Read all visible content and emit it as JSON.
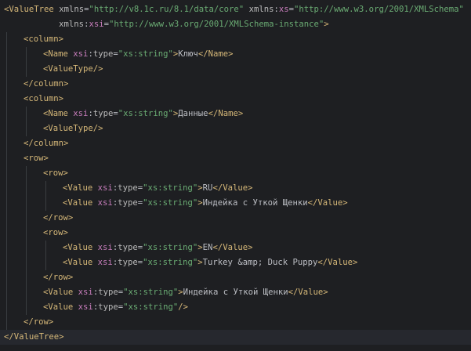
{
  "editor": {
    "language": "XML",
    "lines": [
      {
        "indent": 0,
        "tokens": [
          [
            "b",
            "<"
          ],
          [
            "t",
            "ValueTree"
          ],
          [
            "tx",
            " "
          ],
          [
            "an",
            "xmlns"
          ],
          [
            "p",
            "="
          ],
          [
            "av",
            "\"http://v8.1c.ru/8.1/data/core\""
          ],
          [
            "tx",
            " "
          ],
          [
            "an",
            "xmlns"
          ],
          [
            "p",
            ":"
          ],
          [
            "ap",
            "xs"
          ],
          [
            "p",
            "="
          ],
          [
            "av",
            "\"http://www.w3.org/2001/XMLSchema\""
          ]
        ]
      },
      {
        "indent": 0,
        "tokens": [
          [
            "tx",
            "           "
          ],
          [
            "an",
            "xmlns"
          ],
          [
            "p",
            ":"
          ],
          [
            "ap",
            "xsi"
          ],
          [
            "p",
            "="
          ],
          [
            "av",
            "\"http://www.w3.org/2001/XMLSchema-instance\""
          ],
          [
            "b",
            ">"
          ]
        ]
      },
      {
        "indent": 1,
        "tokens": [
          [
            "b",
            "<"
          ],
          [
            "t",
            "column"
          ],
          [
            "b",
            ">"
          ]
        ]
      },
      {
        "indent": 2,
        "tokens": [
          [
            "b",
            "<"
          ],
          [
            "t",
            "Name"
          ],
          [
            "tx",
            " "
          ],
          [
            "ap",
            "xsi"
          ],
          [
            "p",
            ":"
          ],
          [
            "an",
            "type"
          ],
          [
            "p",
            "="
          ],
          [
            "av",
            "\"xs:string\""
          ],
          [
            "b",
            ">"
          ],
          [
            "tx",
            "Ключ"
          ],
          [
            "b",
            "</"
          ],
          [
            "t",
            "Name"
          ],
          [
            "b",
            ">"
          ]
        ]
      },
      {
        "indent": 2,
        "tokens": [
          [
            "b",
            "<"
          ],
          [
            "t",
            "ValueType"
          ],
          [
            "b",
            "/>"
          ]
        ]
      },
      {
        "indent": 1,
        "tokens": [
          [
            "b",
            "</"
          ],
          [
            "t",
            "column"
          ],
          [
            "b",
            ">"
          ]
        ]
      },
      {
        "indent": 1,
        "tokens": [
          [
            "b",
            "<"
          ],
          [
            "t",
            "column"
          ],
          [
            "b",
            ">"
          ]
        ]
      },
      {
        "indent": 2,
        "tokens": [
          [
            "b",
            "<"
          ],
          [
            "t",
            "Name"
          ],
          [
            "tx",
            " "
          ],
          [
            "ap",
            "xsi"
          ],
          [
            "p",
            ":"
          ],
          [
            "an",
            "type"
          ],
          [
            "p",
            "="
          ],
          [
            "av",
            "\"xs:string\""
          ],
          [
            "b",
            ">"
          ],
          [
            "tx",
            "Данные"
          ],
          [
            "b",
            "</"
          ],
          [
            "t",
            "Name"
          ],
          [
            "b",
            ">"
          ]
        ]
      },
      {
        "indent": 2,
        "tokens": [
          [
            "b",
            "<"
          ],
          [
            "t",
            "ValueType"
          ],
          [
            "b",
            "/>"
          ]
        ]
      },
      {
        "indent": 1,
        "tokens": [
          [
            "b",
            "</"
          ],
          [
            "t",
            "column"
          ],
          [
            "b",
            ">"
          ]
        ]
      },
      {
        "indent": 1,
        "tokens": [
          [
            "b",
            "<"
          ],
          [
            "t",
            "row"
          ],
          [
            "b",
            ">"
          ]
        ]
      },
      {
        "indent": 2,
        "tokens": [
          [
            "b",
            "<"
          ],
          [
            "t",
            "row"
          ],
          [
            "b",
            ">"
          ]
        ]
      },
      {
        "indent": 3,
        "tokens": [
          [
            "b",
            "<"
          ],
          [
            "t",
            "Value"
          ],
          [
            "tx",
            " "
          ],
          [
            "ap",
            "xsi"
          ],
          [
            "p",
            ":"
          ],
          [
            "an",
            "type"
          ],
          [
            "p",
            "="
          ],
          [
            "av",
            "\"xs:string\""
          ],
          [
            "b",
            ">"
          ],
          [
            "tx",
            "RU"
          ],
          [
            "b",
            "</"
          ],
          [
            "t",
            "Value"
          ],
          [
            "b",
            ">"
          ]
        ]
      },
      {
        "indent": 3,
        "tokens": [
          [
            "b",
            "<"
          ],
          [
            "t",
            "Value"
          ],
          [
            "tx",
            " "
          ],
          [
            "ap",
            "xsi"
          ],
          [
            "p",
            ":"
          ],
          [
            "an",
            "type"
          ],
          [
            "p",
            "="
          ],
          [
            "av",
            "\"xs:string\""
          ],
          [
            "b",
            ">"
          ],
          [
            "tx",
            "Индейка с Уткой Щенки"
          ],
          [
            "b",
            "</"
          ],
          [
            "t",
            "Value"
          ],
          [
            "b",
            ">"
          ]
        ]
      },
      {
        "indent": 2,
        "tokens": [
          [
            "b",
            "</"
          ],
          [
            "t",
            "row"
          ],
          [
            "b",
            ">"
          ]
        ]
      },
      {
        "indent": 2,
        "tokens": [
          [
            "b",
            "<"
          ],
          [
            "t",
            "row"
          ],
          [
            "b",
            ">"
          ]
        ]
      },
      {
        "indent": 3,
        "tokens": [
          [
            "b",
            "<"
          ],
          [
            "t",
            "Value"
          ],
          [
            "tx",
            " "
          ],
          [
            "ap",
            "xsi"
          ],
          [
            "p",
            ":"
          ],
          [
            "an",
            "type"
          ],
          [
            "p",
            "="
          ],
          [
            "av",
            "\"xs:string\""
          ],
          [
            "b",
            ">"
          ],
          [
            "tx",
            "EN"
          ],
          [
            "b",
            "</"
          ],
          [
            "t",
            "Value"
          ],
          [
            "b",
            ">"
          ]
        ]
      },
      {
        "indent": 3,
        "tokens": [
          [
            "b",
            "<"
          ],
          [
            "t",
            "Value"
          ],
          [
            "tx",
            " "
          ],
          [
            "ap",
            "xsi"
          ],
          [
            "p",
            ":"
          ],
          [
            "an",
            "type"
          ],
          [
            "p",
            "="
          ],
          [
            "av",
            "\"xs:string\""
          ],
          [
            "b",
            ">"
          ],
          [
            "tx",
            "Turkey &amp; Duck Puppy"
          ],
          [
            "b",
            "</"
          ],
          [
            "t",
            "Value"
          ],
          [
            "b",
            ">"
          ]
        ]
      },
      {
        "indent": 2,
        "tokens": [
          [
            "b",
            "</"
          ],
          [
            "t",
            "row"
          ],
          [
            "b",
            ">"
          ]
        ]
      },
      {
        "indent": 2,
        "tokens": [
          [
            "b",
            "<"
          ],
          [
            "t",
            "Value"
          ],
          [
            "tx",
            " "
          ],
          [
            "ap",
            "xsi"
          ],
          [
            "p",
            ":"
          ],
          [
            "an",
            "type"
          ],
          [
            "p",
            "="
          ],
          [
            "av",
            "\"xs:string\""
          ],
          [
            "b",
            ">"
          ],
          [
            "tx",
            "Индейка с Уткой Щенки"
          ],
          [
            "b",
            "</"
          ],
          [
            "t",
            "Value"
          ],
          [
            "b",
            ">"
          ]
        ]
      },
      {
        "indent": 2,
        "tokens": [
          [
            "b",
            "<"
          ],
          [
            "t",
            "Value"
          ],
          [
            "tx",
            " "
          ],
          [
            "ap",
            "xsi"
          ],
          [
            "p",
            ":"
          ],
          [
            "an",
            "type"
          ],
          [
            "p",
            "="
          ],
          [
            "av",
            "\"xs:string\""
          ],
          [
            "b",
            "/>"
          ]
        ]
      },
      {
        "indent": 1,
        "tokens": [
          [
            "b",
            "</"
          ],
          [
            "t",
            "row"
          ],
          [
            "b",
            ">"
          ]
        ]
      },
      {
        "indent": 0,
        "tokens": [
          [
            "b",
            "</"
          ],
          [
            "t",
            "ValueTree"
          ],
          [
            "b",
            ">"
          ]
        ]
      }
    ]
  },
  "colors": {
    "background": "#1e1f22",
    "tag": "#d5b778",
    "attr_prefix": "#c77dbb",
    "attr_value": "#6aab73",
    "text": "#bcbec4"
  }
}
